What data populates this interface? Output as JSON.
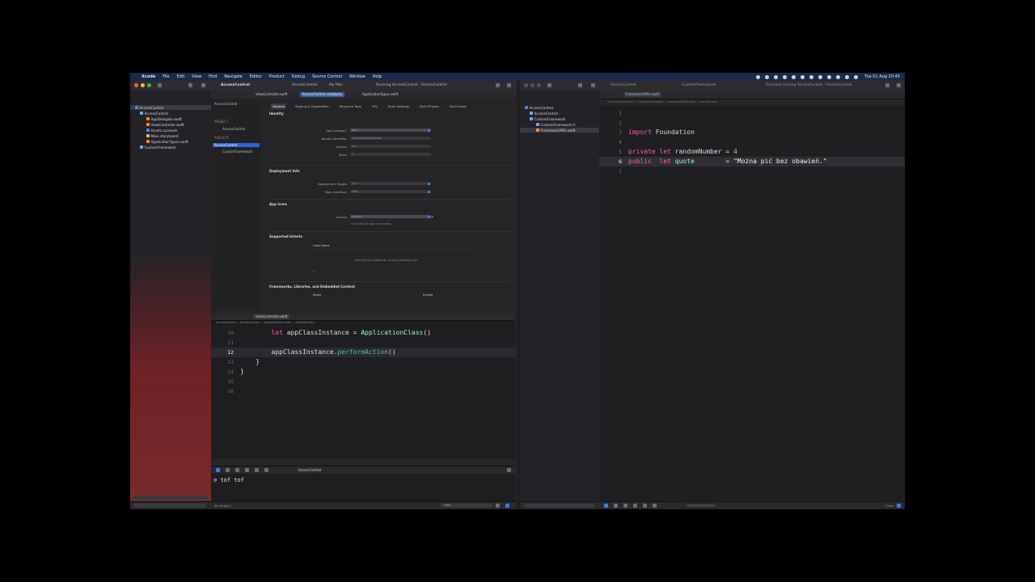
{
  "menubar": {
    "items": [
      "Xcode",
      "File",
      "Edit",
      "View",
      "Find",
      "Navigate",
      "Editor",
      "Product",
      "Debug",
      "Source Control",
      "Window",
      "Help"
    ],
    "clock": "Tue 01 Aug  20:45"
  },
  "window1": {
    "toolbar": {
      "scheme": "AccessControl",
      "device_scheme": "AccessControl",
      "device": "My Mac",
      "status": "Running AccessControl : AccessControl"
    },
    "navigator": {
      "items": [
        {
          "label": "AccessControl"
        },
        {
          "label": "AccessControl"
        },
        {
          "label": "AppDelegate.swift"
        },
        {
          "label": "ViewController.swift"
        },
        {
          "label": "Assets.xcassets"
        },
        {
          "label": "Main.storyboard"
        },
        {
          "label": "ApplicationTypes.swift"
        },
        {
          "label": "CustomFramework"
        }
      ]
    },
    "editor_tabs": [
      "ViewController.swift",
      "AccessControl.xcodeproj",
      "ApplicationTypes.swift"
    ],
    "project_editor": {
      "breadcrumb": "AccessControl",
      "left": {
        "project_header": "PROJECT",
        "project_item": "AccessControl",
        "targets_header": "TARGETS",
        "targets": [
          "AccessControl",
          "CustomFramework"
        ]
      },
      "settings_tabs": [
        "General",
        "Signing & Capabilities",
        "Resource Tags",
        "Info",
        "Build Settings",
        "Build Phases",
        "Build Rules"
      ],
      "sections": {
        "identity": "Identity",
        "deployment": "Deployment Info",
        "app_icons": "App Icons",
        "intents": "Supported Intents",
        "frameworks": "Frameworks, Libraries, and Embedded Content"
      },
      "fields": {
        "app_category": {
          "label": "App Category",
          "value": "None"
        },
        "bundle_identifier": {
          "label": "Bundle Identifier",
          "value": "com.xcg.AccessControl"
        },
        "version": {
          "label": "Version",
          "value": "1.0"
        },
        "build": {
          "label": "Build",
          "value": "1"
        },
        "deployment_target": {
          "label": "Deployment Target",
          "value": "13.1"
        },
        "main_interface": {
          "label": "Main Interface",
          "value": "Main"
        },
        "source": {
          "label": "Source",
          "value": "AppIcon"
        }
      },
      "include_all_icons": "Include all app icon assets",
      "class_name_header": "Class Name",
      "intents_placeholder": "Add intents eligible for in-app handling here",
      "name_header": "Name",
      "embed_header": "Embed",
      "plus": "+"
    },
    "code_editor": {
      "tab": "ViewController.swift",
      "breadcrumb": "AccessControl  〉  AccessControl  〉  ViewController.swift  〉  viewDidLoad()",
      "lines": [
        {
          "num": "10",
          "indent": "        ",
          "kw": "let",
          "rest1": " appClassInstance = ",
          "ty": "ApplicationClass",
          "rest2": "()"
        },
        {
          "num": "11"
        },
        {
          "num": "12",
          "indent": "        ",
          "obj": "appClassInstance.",
          "method": "performAction",
          "rest2": "()"
        },
        {
          "num": "13",
          "text": "    }"
        },
        {
          "num": "14",
          "text": "}"
        },
        {
          "num": "15"
        },
        {
          "num": "16"
        }
      ]
    },
    "debug": {
      "target": "AccessControl",
      "console_text": "tof tof",
      "status_left": "All Output ◊",
      "filter": "Filter"
    }
  },
  "window2": {
    "navigator": {
      "items": [
        {
          "label": "AccessControl"
        },
        {
          "label": "AccessControl"
        },
        {
          "label": "CustomFramework"
        },
        {
          "label": "CustomFramework.h"
        },
        {
          "label": "FrameworkAPIs.swift"
        }
      ]
    },
    "tabs": [
      "AccessControl",
      "CustomFramework",
      "Finished running AccessControl : AccessControl"
    ],
    "editor_tab": "FrameworkAPIs.swift",
    "breadcrumb": "CustomFramework  〉  CustomFramework  〉  FrameworkAPIs.swift  〉  No Selection",
    "lines": [
      {
        "num": "1"
      },
      {
        "num": "2"
      },
      {
        "num": "3",
        "kw": "import",
        "rest": " Foundation"
      },
      {
        "num": "4"
      },
      {
        "num": "5",
        "kw": "private let",
        "rest": " randomNumber = ",
        "num_val": "4"
      },
      {
        "num": "6",
        "kw": "public  let",
        "ident": " quote",
        "rest": "        = ",
        "str": "\"Można pić bez obawień.\""
      },
      {
        "num": "7"
      }
    ],
    "status_right": "1 line"
  },
  "colors": {
    "menubar": "#1a2a4a",
    "accent": "#2f62d6",
    "keyword": "#fc5fa3",
    "type": "#9ef0d0",
    "string": "#fc6a5d",
    "number": "#d0bf69"
  }
}
